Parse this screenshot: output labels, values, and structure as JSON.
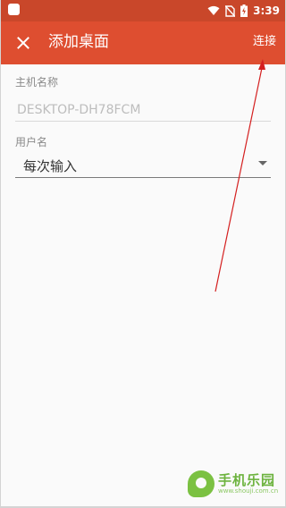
{
  "colors": {
    "status_bar": "#c9472a",
    "app_bar": "#de4e30",
    "background": "#fafafa",
    "annotation_arrow": "#d41f1f"
  },
  "status_bar": {
    "time": "3:39",
    "icons": [
      "app-notification-icon",
      "wifi-icon",
      "no-sim-icon",
      "battery-charging-icon"
    ]
  },
  "app_bar": {
    "close_icon": "close-icon",
    "title": "添加桌面",
    "action_label": "连接"
  },
  "form": {
    "host_label": "主机名称",
    "host_placeholder": "DESKTOP-DH78FCM",
    "user_label": "用户名",
    "user_selected": "每次输入"
  },
  "watermark": {
    "main": "手机乐园",
    "sub": "www.shouji.com.cn"
  }
}
